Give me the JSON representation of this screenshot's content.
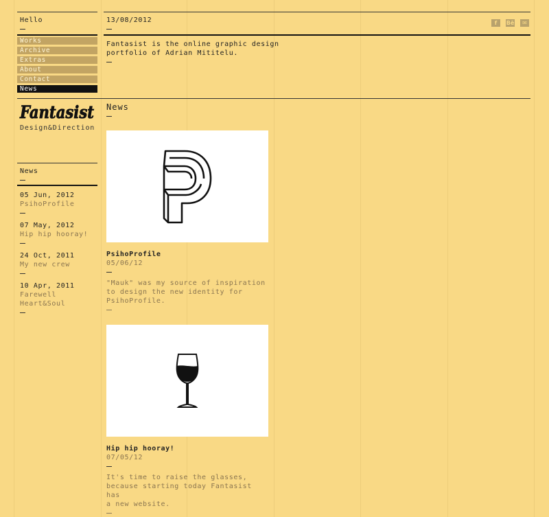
{
  "sidebar": {
    "greeting": "Hello",
    "nav": [
      "Works",
      "Archive",
      "Extras",
      "About",
      "Contact",
      "News"
    ],
    "active_nav": "News",
    "logo_text": "Fantasist",
    "tagline": "Design&Direction",
    "news_title": "News",
    "news_items": [
      {
        "date": "05 Jun, 2012",
        "title": "PsihoProfile"
      },
      {
        "date": "07 May, 2012",
        "title": "Hip hip hooray!"
      },
      {
        "date": "24 Oct, 2011",
        "title": "My new crew"
      },
      {
        "date": "10 Apr, 2011",
        "title": "Farewell Heart&Soul"
      }
    ]
  },
  "header": {
    "date": "13/08/2012",
    "social": [
      {
        "icon": "facebook-icon",
        "glyph": "f"
      },
      {
        "icon": "behance-icon",
        "glyph": "Bē"
      },
      {
        "icon": "mail-icon",
        "glyph": "✉"
      }
    ]
  },
  "intro": {
    "line1": "Fantasist is the online graphic design",
    "line2": "portfolio of Adrian Mititelu."
  },
  "main": {
    "title": "News",
    "posts": [
      {
        "title": "PsihoProfile",
        "date": "05/06/12",
        "desc1": "\"Mauk\" was my source of inspiration",
        "desc2": "to design the new identity for",
        "desc3": "PsihoProfile.",
        "image_icon": "letter-p-logo-icon"
      },
      {
        "title": "Hip hip hooray!",
        "date": "07/05/12",
        "desc1": "It's time to raise the glasses,",
        "desc2": "because starting today Fantasist has",
        "desc3": "a new website.",
        "image_icon": "wine-glass-icon"
      }
    ]
  },
  "colors": {
    "background": "#f9d985",
    "nav_bg": "#c2a463",
    "nav_active": "#111111",
    "muted_text": "#8a7550"
  }
}
